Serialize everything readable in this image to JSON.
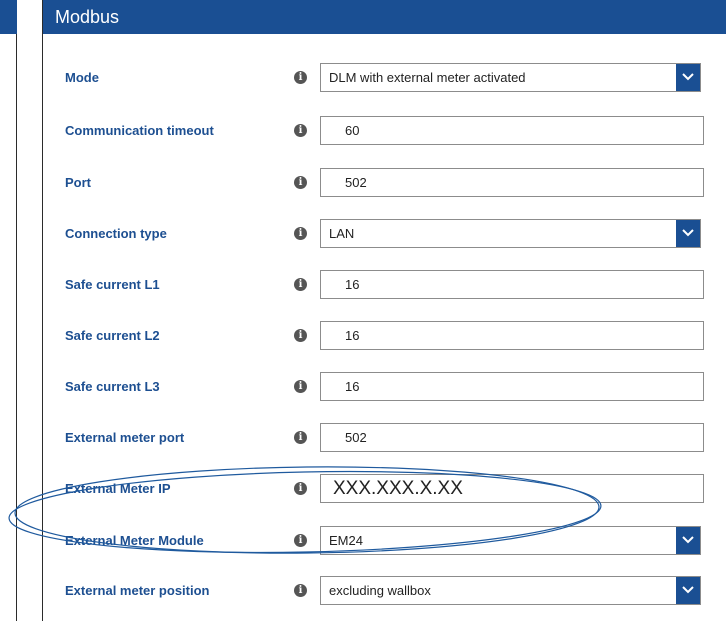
{
  "panel": {
    "title": "Modbus"
  },
  "rows": [
    {
      "label": "Mode",
      "value": "DLM with external meter activated"
    },
    {
      "label": "Communication timeout",
      "value": "60"
    },
    {
      "label": "Port",
      "value": "502"
    },
    {
      "label": "Connection type",
      "value": "LAN"
    },
    {
      "label": "Safe current L1",
      "value": "16"
    },
    {
      "label": "Safe current L2",
      "value": "16"
    },
    {
      "label": "Safe current L3",
      "value": "16"
    },
    {
      "label": "External meter port",
      "value": "502"
    },
    {
      "label": "External Meter IP",
      "value": "XXX.XXX.X.XX"
    },
    {
      "label": "External Meter Module",
      "value": "EM24"
    },
    {
      "label": "External meter position",
      "value": "excluding wallbox"
    }
  ],
  "icons": {
    "info": "info-circle-icon",
    "dropdown": "chevron-down-icon"
  },
  "colors": {
    "header": "#1a4f93",
    "label": "#1d4f91",
    "highlight": "#1f5a9e"
  }
}
